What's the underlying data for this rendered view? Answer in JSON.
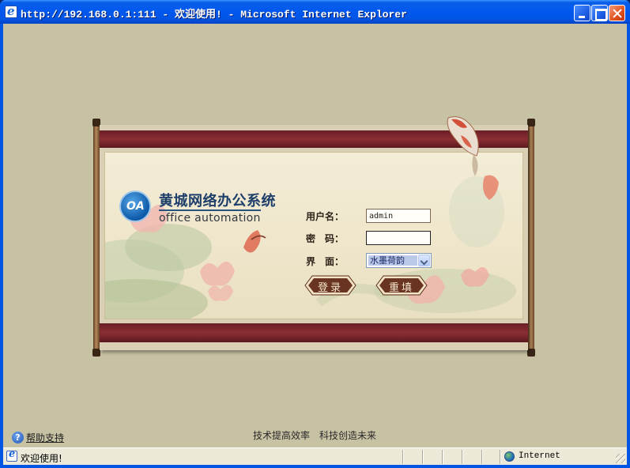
{
  "window": {
    "title": "http://192.168.0.1:111 - 欢迎使用! - Microsoft Internet Explorer",
    "minimize_icon": "minimize-icon",
    "maximize_icon": "maximize-icon",
    "close_icon": "close-icon"
  },
  "logo": {
    "mark": "OA",
    "name_cn": "黄城网络办公系统",
    "name_en": "office automation"
  },
  "login_form": {
    "username_label": "用户名：",
    "username_value": "admin",
    "password_label": "密　码：",
    "password_value": "",
    "skin_label": "界　面：",
    "skin_selected": "水墨荷韵",
    "login_button": "登录",
    "reset_button": "重填"
  },
  "footer": {
    "help_icon": "help-icon",
    "help_text": "帮助支持",
    "slogan_1": "技术提高效率",
    "slogan_2": "科技创造未来"
  },
  "statusbar": {
    "text": "欢迎使用!",
    "zone": "Internet"
  },
  "colors": {
    "page_bg": "#c8c2a4",
    "scroll_band": "#7a2630",
    "button_fill": "#6a3a2a",
    "titlebar": "#0055e5"
  }
}
